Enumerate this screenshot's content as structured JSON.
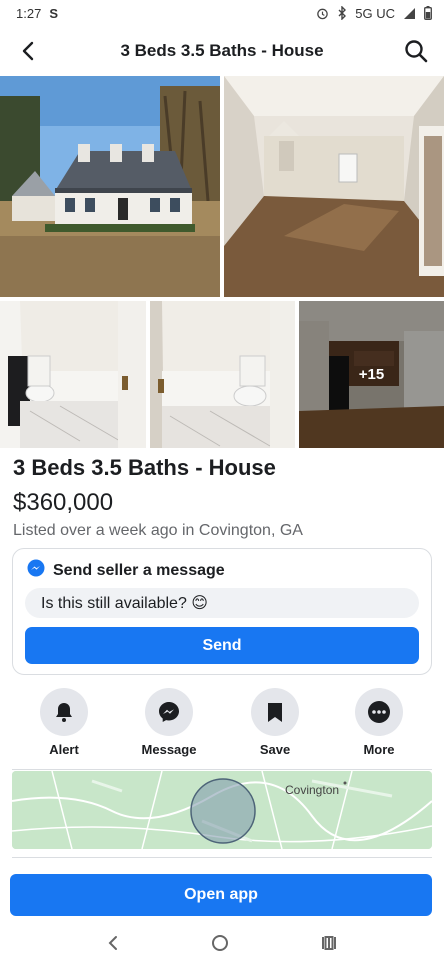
{
  "status_bar": {
    "time": "1:27",
    "carrier_icon": "S",
    "network": "5G UC"
  },
  "header": {
    "title": "3 Beds 3.5 Baths - House"
  },
  "photos": {
    "more_count": "+15"
  },
  "listing": {
    "title": "3 Beds 3.5 Baths - House",
    "price": "$360,000",
    "listed": "Listed over a week ago in Covington, GA"
  },
  "message": {
    "heading": "Send seller a message",
    "input_value": "Is this still available? 😊",
    "send_label": "Send"
  },
  "actions": [
    {
      "label": "Alert",
      "icon": "bell-icon"
    },
    {
      "label": "Message",
      "icon": "messenger-icon"
    },
    {
      "label": "Save",
      "icon": "bookmark-icon"
    },
    {
      "label": "More",
      "icon": "more-icon"
    }
  ],
  "map": {
    "label": "Covington"
  },
  "open_app": {
    "label": "Open app"
  },
  "colors": {
    "accent": "#1877f2",
    "button_gray": "#e4e6eb",
    "secondary_text": "#65676b"
  }
}
